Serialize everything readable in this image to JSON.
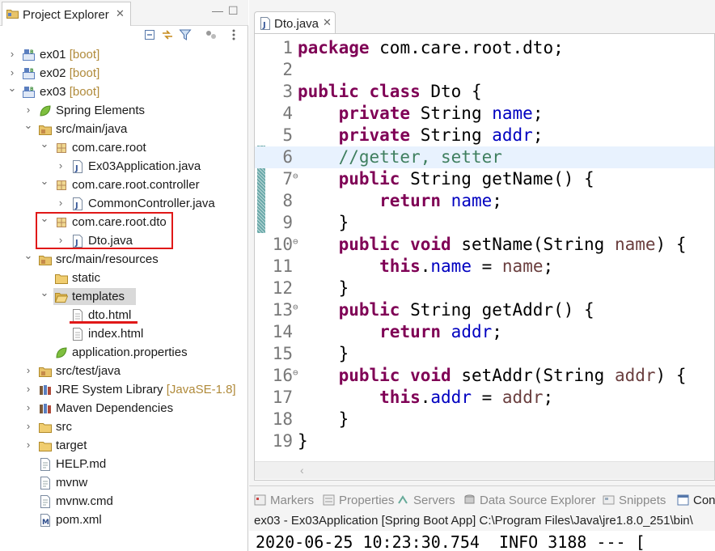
{
  "project_explorer": {
    "title": "Project Explorer",
    "tree": [
      {
        "id": "ex01",
        "label": "ex01",
        "decoration": "[boot]",
        "icon": "boot-project-icon",
        "level": 0,
        "expanded": false
      },
      {
        "id": "ex02",
        "label": "ex02",
        "decoration": "[boot]",
        "icon": "boot-project-icon",
        "level": 0,
        "expanded": false
      },
      {
        "id": "ex03",
        "label": "ex03",
        "decoration": "[boot]",
        "icon": "boot-project-icon",
        "level": 0,
        "expanded": true
      },
      {
        "id": "spring-elements",
        "label": "Spring Elements",
        "icon": "spring-leaf-icon",
        "level": 1,
        "expanded": false
      },
      {
        "id": "src-main-java",
        "label": "src/main/java",
        "icon": "source-folder-icon",
        "level": 1,
        "expanded": true
      },
      {
        "id": "pkg-root",
        "label": "com.care.root",
        "icon": "package-icon",
        "level": 2,
        "expanded": true
      },
      {
        "id": "ex03-app",
        "label": "Ex03Application.java",
        "icon": "java-file-icon",
        "level": 3,
        "expanded": false
      },
      {
        "id": "pkg-controller",
        "label": "com.care.root.controller",
        "icon": "package-icon",
        "level": 2,
        "expanded": true
      },
      {
        "id": "common-controller",
        "label": "CommonController.java",
        "icon": "java-file-icon",
        "level": 3,
        "expanded": false
      },
      {
        "id": "pkg-dto",
        "label": "com.care.root.dto",
        "icon": "package-icon",
        "level": 2,
        "expanded": true
      },
      {
        "id": "dto-java",
        "label": "Dto.java",
        "icon": "java-file-icon",
        "level": 3,
        "expanded": false
      },
      {
        "id": "src-main-resources",
        "label": "src/main/resources",
        "icon": "source-folder-icon",
        "level": 1,
        "expanded": true
      },
      {
        "id": "static",
        "label": "static",
        "icon": "folder-icon",
        "level": 2,
        "expanded": null
      },
      {
        "id": "templates",
        "label": "templates",
        "icon": "folder-open-icon",
        "level": 2,
        "expanded": true,
        "selected": true
      },
      {
        "id": "dto-html",
        "label": "dto.html",
        "icon": "html-file-icon",
        "level": 3,
        "expanded": null
      },
      {
        "id": "index-html",
        "label": "index.html",
        "icon": "html-file-icon",
        "level": 3,
        "expanded": null
      },
      {
        "id": "app-props",
        "label": "application.properties",
        "icon": "spring-leaf-icon",
        "level": 2,
        "expanded": null
      },
      {
        "id": "src-test-java",
        "label": "src/test/java",
        "icon": "source-folder-icon",
        "level": 1,
        "expanded": false
      },
      {
        "id": "jre-lib",
        "label": "JRE System Library",
        "decoration": "[JavaSE-1.8]",
        "icon": "library-icon",
        "level": 1,
        "expanded": false
      },
      {
        "id": "maven-deps",
        "label": "Maven Dependencies",
        "icon": "library-icon",
        "level": 1,
        "expanded": false
      },
      {
        "id": "src",
        "label": "src",
        "icon": "folder-icon",
        "level": 1,
        "expanded": false
      },
      {
        "id": "target",
        "label": "target",
        "icon": "folder-icon",
        "level": 1,
        "expanded": false
      },
      {
        "id": "help-md",
        "label": "HELP.md",
        "icon": "text-file-icon",
        "level": 1,
        "expanded": null
      },
      {
        "id": "mvnw",
        "label": "mvnw",
        "icon": "text-file-icon",
        "level": 1,
        "expanded": null
      },
      {
        "id": "mvnw-cmd",
        "label": "mvnw.cmd",
        "icon": "text-file-icon",
        "level": 1,
        "expanded": null
      },
      {
        "id": "pom-xml",
        "label": "pom.xml",
        "icon": "maven-pom-icon",
        "level": 1,
        "expanded": null
      }
    ]
  },
  "editor": {
    "tab_title": "Dto.java",
    "lines": [
      {
        "num": "1",
        "fold": false,
        "current": false,
        "tokens": [
          [
            "kw",
            "package"
          ],
          [
            "t",
            " com.care.root.dto;"
          ]
        ]
      },
      {
        "num": "2",
        "fold": false,
        "current": false,
        "tokens": []
      },
      {
        "num": "3",
        "fold": false,
        "current": false,
        "tokens": [
          [
            "kw",
            "public"
          ],
          [
            "t",
            " "
          ],
          [
            "kw",
            "class"
          ],
          [
            "t",
            " Dto {"
          ]
        ]
      },
      {
        "num": "4",
        "fold": false,
        "current": false,
        "tokens": [
          [
            "t",
            "    "
          ],
          [
            "kw",
            "private"
          ],
          [
            "t",
            " String "
          ],
          [
            "fld",
            "name"
          ],
          [
            "t",
            ";"
          ]
        ]
      },
      {
        "num": "5",
        "fold": false,
        "current": false,
        "tokens": [
          [
            "t",
            "    "
          ],
          [
            "kw",
            "private"
          ],
          [
            "t",
            " String "
          ],
          [
            "fld",
            "addr"
          ],
          [
            "t",
            ";"
          ]
        ]
      },
      {
        "num": "6",
        "fold": false,
        "current": true,
        "tokens": [
          [
            "t",
            "    "
          ],
          [
            "cm",
            "//getter, setter"
          ]
        ]
      },
      {
        "num": "7",
        "fold": true,
        "current": false,
        "tokens": [
          [
            "t",
            "    "
          ],
          [
            "kw",
            "public"
          ],
          [
            "t",
            " String getName() {"
          ]
        ]
      },
      {
        "num": "8",
        "fold": false,
        "current": false,
        "tokens": [
          [
            "t",
            "        "
          ],
          [
            "kw",
            "return"
          ],
          [
            "t",
            " "
          ],
          [
            "fld",
            "name"
          ],
          [
            "t",
            ";"
          ]
        ]
      },
      {
        "num": "9",
        "fold": false,
        "current": false,
        "tokens": [
          [
            "t",
            "    }"
          ]
        ]
      },
      {
        "num": "10",
        "fold": true,
        "current": false,
        "tokens": [
          [
            "t",
            "    "
          ],
          [
            "kw",
            "public"
          ],
          [
            "t",
            " "
          ],
          [
            "kw",
            "void"
          ],
          [
            "t",
            " setName(String "
          ],
          [
            "var",
            "name"
          ],
          [
            "t",
            ") {"
          ]
        ]
      },
      {
        "num": "11",
        "fold": false,
        "current": false,
        "tokens": [
          [
            "t",
            "        "
          ],
          [
            "kw",
            "this"
          ],
          [
            "t",
            "."
          ],
          [
            "fld",
            "name"
          ],
          [
            "t",
            " = "
          ],
          [
            "var",
            "name"
          ],
          [
            "t",
            ";"
          ]
        ]
      },
      {
        "num": "12",
        "fold": false,
        "current": false,
        "tokens": [
          [
            "t",
            "    }"
          ]
        ]
      },
      {
        "num": "13",
        "fold": true,
        "current": false,
        "tokens": [
          [
            "t",
            "    "
          ],
          [
            "kw",
            "public"
          ],
          [
            "t",
            " String getAddr() {"
          ]
        ]
      },
      {
        "num": "14",
        "fold": false,
        "current": false,
        "tokens": [
          [
            "t",
            "        "
          ],
          [
            "kw",
            "return"
          ],
          [
            "t",
            " "
          ],
          [
            "fld",
            "addr"
          ],
          [
            "t",
            ";"
          ]
        ]
      },
      {
        "num": "15",
        "fold": false,
        "current": false,
        "tokens": [
          [
            "t",
            "    }"
          ]
        ]
      },
      {
        "num": "16",
        "fold": true,
        "current": false,
        "tokens": [
          [
            "t",
            "    "
          ],
          [
            "kw",
            "public"
          ],
          [
            "t",
            " "
          ],
          [
            "kw",
            "void"
          ],
          [
            "t",
            " setAddr(String "
          ],
          [
            "var",
            "addr"
          ],
          [
            "t",
            ") {"
          ]
        ]
      },
      {
        "num": "17",
        "fold": false,
        "current": false,
        "tokens": [
          [
            "t",
            "        "
          ],
          [
            "kw",
            "this"
          ],
          [
            "t",
            "."
          ],
          [
            "fld",
            "addr"
          ],
          [
            "t",
            " = "
          ],
          [
            "var",
            "addr"
          ],
          [
            "t",
            ";"
          ]
        ]
      },
      {
        "num": "18",
        "fold": false,
        "current": false,
        "tokens": [
          [
            "t",
            "    }"
          ]
        ]
      },
      {
        "num": "19",
        "fold": false,
        "current": false,
        "tokens": [
          [
            "t",
            "}"
          ]
        ]
      }
    ]
  },
  "bottom_panel": {
    "tabs": [
      {
        "label": "Markers",
        "icon": "markers-icon",
        "active": false
      },
      {
        "label": "Properties",
        "icon": "properties-icon",
        "active": false
      },
      {
        "label": "Servers",
        "icon": "servers-icon",
        "active": false
      },
      {
        "label": "Data Source Explorer",
        "icon": "data-source-icon",
        "active": false
      },
      {
        "label": "Snippets",
        "icon": "snippets-icon",
        "active": false
      },
      {
        "label": "Con",
        "icon": "console-icon",
        "active": true
      }
    ],
    "console_title": "ex03 - Ex03Application [Spring Boot App] C:\\Program Files\\Java\\jre1.8.0_251\\bin\\",
    "console_output": "2020-06-25 10:23:30.754  INFO 3188 --- ["
  },
  "colors": {
    "keyword": "#7f0055",
    "field": "#0000c0",
    "comment": "#3f7f5f",
    "parameter": "#6a3e3e",
    "highlight": "#e01818",
    "current_line": "#e8f2fe"
  }
}
